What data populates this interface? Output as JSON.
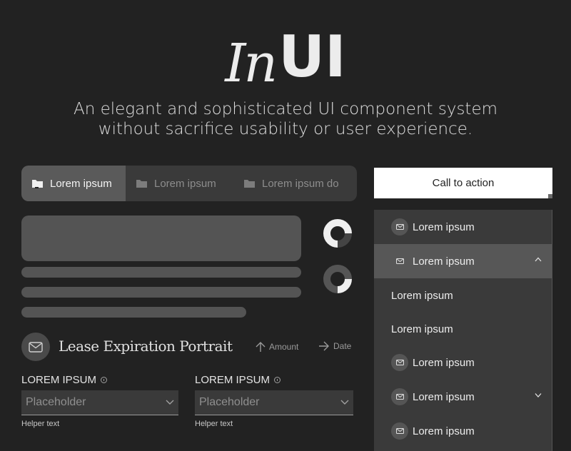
{
  "header": {
    "logo_italic": "In",
    "logo_bold": "UI",
    "tagline_line1": "An elegant and sophisticated UI component system",
    "tagline_line2": "without sacrifice usability or user experience."
  },
  "tabs": [
    {
      "label": "Lorem ipsum",
      "icon": "folder-icon",
      "active": true
    },
    {
      "label": "Lorem ipsum",
      "icon": "folder-icon",
      "active": false
    },
    {
      "label": "Lorem ipsum do",
      "icon": "folder-icon",
      "active": false
    }
  ],
  "loaders": [
    {
      "icon": "donut-spinner",
      "progress": 0.25
    },
    {
      "icon": "donut-spinner",
      "progress": 0.25
    }
  ],
  "lease": {
    "title": "Lease Expiration Portrait",
    "icon": "mail-icon",
    "sort_amount": "Amount",
    "sort_date": "Date"
  },
  "fields": [
    {
      "label": "LOREM IPSUM",
      "placeholder": "Placeholder",
      "helper": "Helper text"
    },
    {
      "label": "LOREM IPSUM",
      "placeholder": "Placeholder",
      "helper": "Helper text"
    }
  ],
  "cta": {
    "label": "Call to action"
  },
  "menu": {
    "items": [
      {
        "label": "Lorem ipsum",
        "icon": "mail-icon"
      },
      {
        "label": "Lorem ipsum",
        "icon": "mail-icon",
        "expanded": true
      },
      {
        "label": "Lorem ipsum"
      },
      {
        "label": "Lorem ipsum"
      },
      {
        "label": "Lorem ipsum",
        "icon": "mail-icon"
      },
      {
        "label": "Lorem ipsum",
        "icon": "mail-icon",
        "collapsed": true
      },
      {
        "label": "Lorem ipsum",
        "icon": "mail-icon"
      }
    ]
  },
  "colors": {
    "background": "#222222",
    "surface": "#3a3a3a",
    "highlight": "#575757",
    "cta_bg": "#ffffff"
  }
}
